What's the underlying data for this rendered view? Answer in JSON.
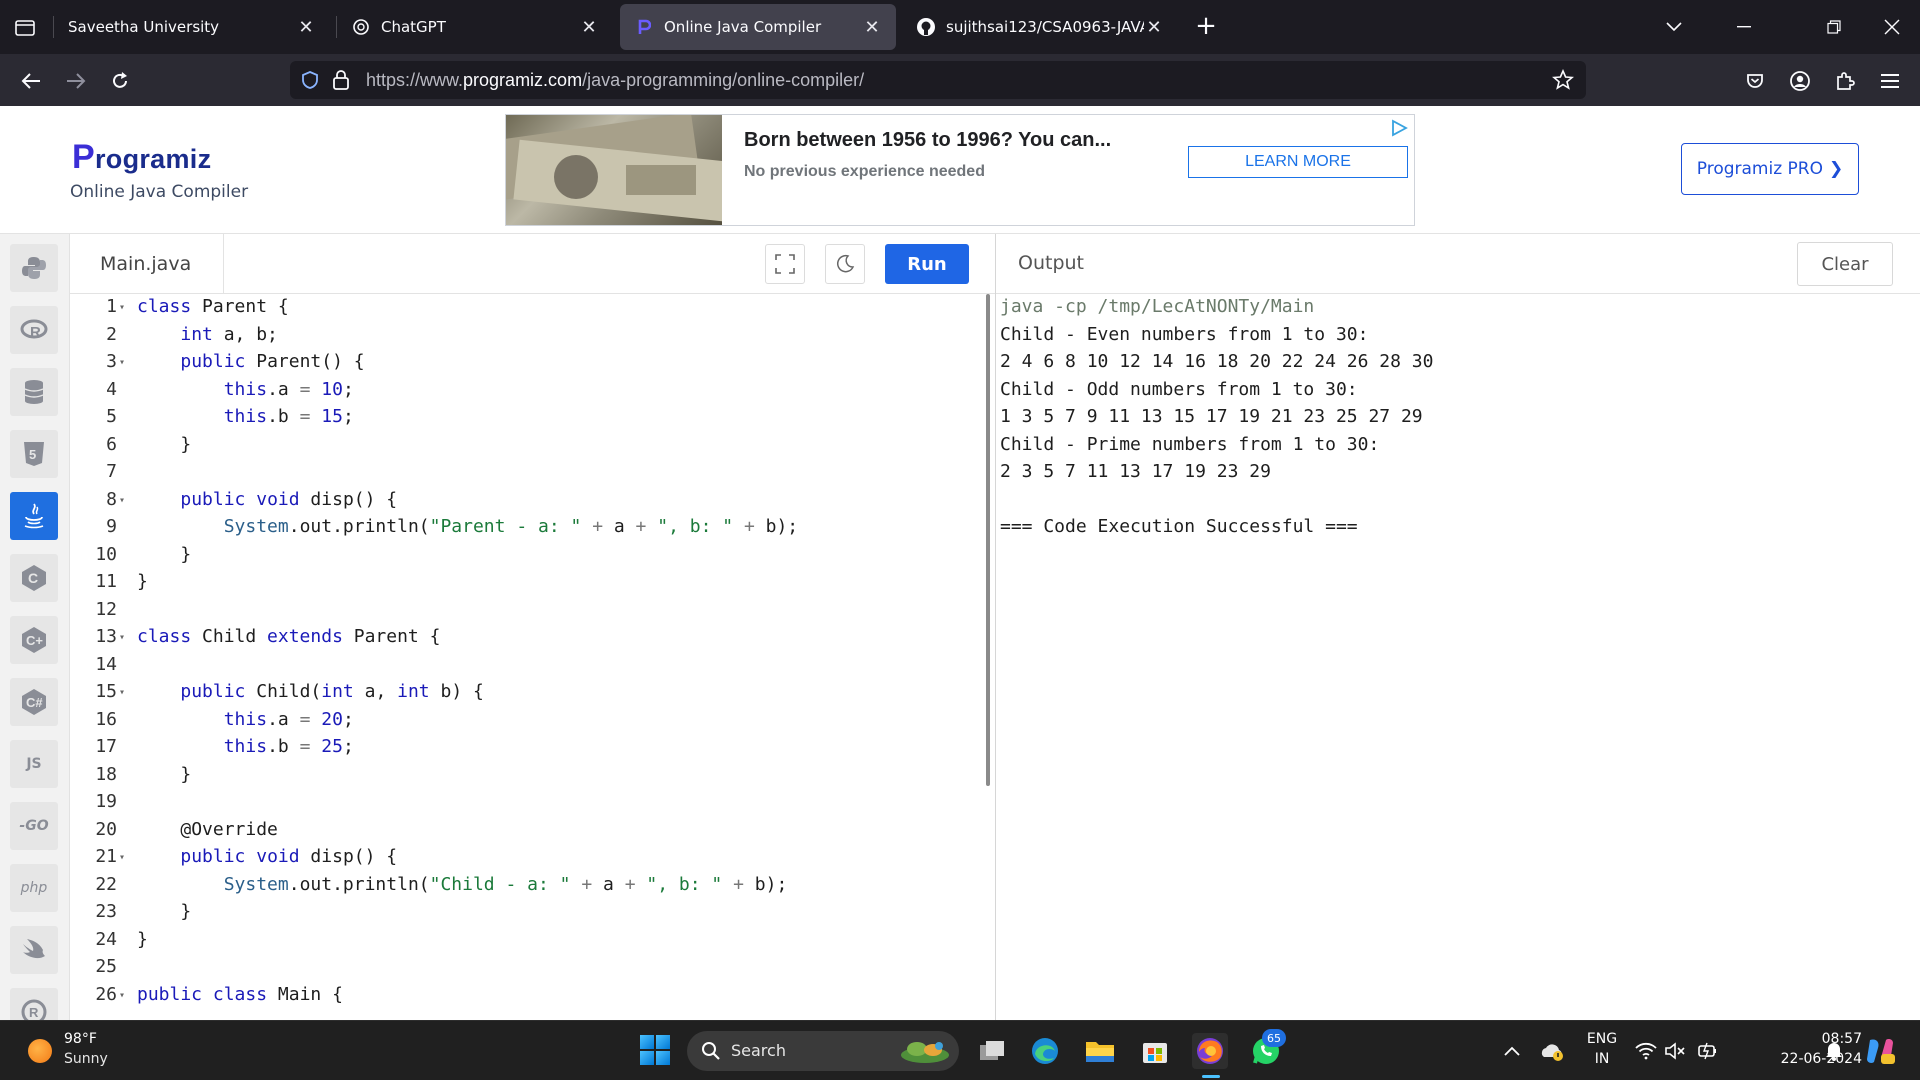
{
  "browser": {
    "tabs": [
      {
        "title": "Saveetha University",
        "active": false
      },
      {
        "title": "ChatGPT",
        "active": false
      },
      {
        "title": "Online Java Compiler",
        "active": true
      },
      {
        "title": "sujithsai123/CSA0963-JAVA-192",
        "active": false
      }
    ],
    "url_prefix": "https://www.",
    "url_host": "programiz.com",
    "url_path": "/java-programming/online-compiler/"
  },
  "header": {
    "logo_first": "P",
    "logo_rest": "rogramiz",
    "subtitle": "Online Java Compiler",
    "pro_button": "Programiz PRO",
    "ad": {
      "headline": "Born between 1956 to 1996? You can...",
      "subline": "No previous experience needed",
      "cta": "LEARN MORE"
    }
  },
  "sidebar": {
    "languages": [
      {
        "name": "python",
        "glyph": ""
      },
      {
        "name": "r",
        "glyph": "R"
      },
      {
        "name": "sql",
        "glyph": ""
      },
      {
        "name": "html",
        "glyph": "5"
      },
      {
        "name": "java",
        "glyph": "",
        "active": true
      },
      {
        "name": "c",
        "glyph": "C"
      },
      {
        "name": "cpp",
        "glyph": "C"
      },
      {
        "name": "csharp",
        "glyph": "C"
      },
      {
        "name": "javascript",
        "glyph": "JS"
      },
      {
        "name": "go",
        "glyph": "-GO"
      },
      {
        "name": "php",
        "glyph": "php"
      },
      {
        "name": "swift",
        "glyph": ""
      },
      {
        "name": "rust",
        "glyph": "R"
      }
    ]
  },
  "editor": {
    "file_name": "Main.java",
    "run_label": "Run",
    "lines": [
      {
        "n": "1",
        "fold": true,
        "code": "class Parent {"
      },
      {
        "n": "2",
        "fold": false,
        "code": "    int a, b;"
      },
      {
        "n": "3",
        "fold": true,
        "code": "    public Parent() {"
      },
      {
        "n": "4",
        "fold": false,
        "code": "        this.a = 10;"
      },
      {
        "n": "5",
        "fold": false,
        "code": "        this.b = 15;"
      },
      {
        "n": "6",
        "fold": false,
        "code": "    }"
      },
      {
        "n": "7",
        "fold": false,
        "code": ""
      },
      {
        "n": "8",
        "fold": true,
        "code": "    public void disp() {"
      },
      {
        "n": "9",
        "fold": false,
        "code": "        System.out.println(\"Parent - a: \" + a + \", b: \" + b);"
      },
      {
        "n": "10",
        "fold": false,
        "code": "    }"
      },
      {
        "n": "11",
        "fold": false,
        "code": "}"
      },
      {
        "n": "12",
        "fold": false,
        "code": ""
      },
      {
        "n": "13",
        "fold": true,
        "code": "class Child extends Parent {"
      },
      {
        "n": "14",
        "fold": false,
        "code": ""
      },
      {
        "n": "15",
        "fold": true,
        "code": "    public Child(int a, int b) {"
      },
      {
        "n": "16",
        "fold": false,
        "code": "        this.a = 20;"
      },
      {
        "n": "17",
        "fold": false,
        "code": "        this.b = 25;"
      },
      {
        "n": "18",
        "fold": false,
        "code": "    }"
      },
      {
        "n": "19",
        "fold": false,
        "code": ""
      },
      {
        "n": "20",
        "fold": false,
        "code": "    @Override"
      },
      {
        "n": "21",
        "fold": true,
        "code": "    public void disp() {"
      },
      {
        "n": "22",
        "fold": false,
        "code": "        System.out.println(\"Child - a: \" + a + \", b: \" + b);"
      },
      {
        "n": "23",
        "fold": false,
        "code": "    }"
      },
      {
        "n": "24",
        "fold": false,
        "code": "}"
      },
      {
        "n": "25",
        "fold": false,
        "code": ""
      },
      {
        "n": "26",
        "fold": true,
        "code": "public class Main {"
      }
    ]
  },
  "output": {
    "title": "Output",
    "clear_label": "Clear",
    "lines": [
      "java -cp /tmp/LecAtNONTy/Main",
      "Child - Even numbers from 1 to 30:",
      "2 4 6 8 10 12 14 16 18 20 22 24 26 28 30",
      "Child - Odd numbers from 1 to 30:",
      "1 3 5 7 9 11 13 15 17 19 21 23 25 27 29",
      "Child - Prime numbers from 1 to 30:",
      "2 3 5 7 11 13 17 19 23 29",
      "",
      "=== Code Execution Successful ==="
    ]
  },
  "taskbar": {
    "weather_temp": "98°F",
    "weather_cond": "Sunny",
    "search_placeholder": "Search",
    "whatsapp_badge": "65",
    "lang_top": "ENG",
    "lang_bottom": "IN",
    "time": "08:57",
    "date": "22-06-2024"
  }
}
